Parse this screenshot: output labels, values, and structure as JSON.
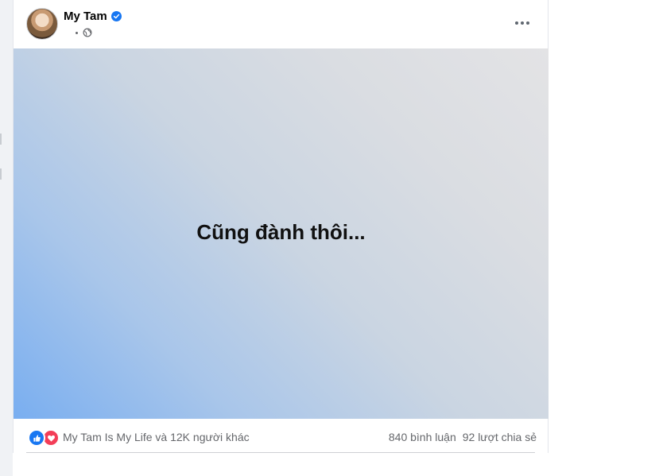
{
  "post": {
    "author": "My Tam",
    "verified_icon": "verified-badge-icon",
    "privacy_icon": "globe-icon",
    "more_icon": "more-options-icon",
    "status_text": "Cũng đành thôi...",
    "background_colors": [
      "#79aef0",
      "#cad5e2",
      "#e3e3e5"
    ]
  },
  "footer": {
    "reaction_icons": [
      "like-icon",
      "love-icon"
    ],
    "reaction_summary": "My Tam Is My Life và 12K người khác",
    "comments": "840 bình luận",
    "shares": "92 lượt chia sẻ"
  },
  "colors": {
    "like": "#1877f2",
    "love": "#f33e58",
    "verified": "#1877f2",
    "secondary_text": "#65676b"
  }
}
